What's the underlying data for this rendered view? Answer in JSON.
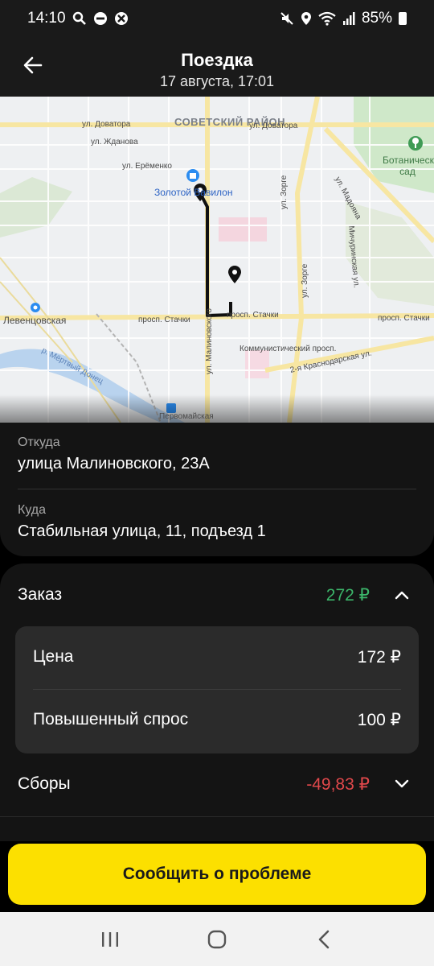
{
  "status_bar": {
    "time": "14:10",
    "battery": "85%",
    "left_icons": [
      "search-icon",
      "dnd-icon",
      "app-icon"
    ],
    "right_icons": [
      "mute-icon",
      "location-icon",
      "wifi-icon",
      "signal-icon",
      "battery-icon"
    ]
  },
  "header": {
    "title": "Поездка",
    "subtitle": "17 августа, 17:01"
  },
  "map": {
    "labels": {
      "district": "СОВЕТСКИЙ РАЙОН",
      "dovatora_1": "ул. Доватора",
      "dovatora_2": "ул. Доватора",
      "zhdanova": "ул. Жданова",
      "eremenko": "ул. Ерёменко",
      "zolotoy": "Золотой Вавилон",
      "botanic": "Ботанический сад",
      "madoyana": "ул. Мадояна",
      "zorge_1": "ул. Зорге",
      "zorge_2": "ул. Зорге",
      "michurinskaya": "Мичуринская ул.",
      "stachki_1": "просп. Стачки",
      "stachki_2": "просп. Стачки",
      "stachki_3": "просп. Стачки",
      "malinovskogo": "ул. Малиновского",
      "kommunisticheskiy": "Коммунистический просп.",
      "krasnodarskaya": "2-я Краснодарская ул.",
      "levencovskaya": "Левенцовская",
      "mertvy_donec": "р. Мёртвый Донец",
      "pervomayskaya": "Первомайская"
    },
    "route_color": "#111111"
  },
  "trip": {
    "from_caption": "Откуда",
    "from_value": "улица Малиновского, 23А",
    "to_caption": "Куда",
    "to_value": "Стабильная улица, 11, подъезд 1"
  },
  "order": {
    "label": "Заказ",
    "amount": "272 ₽",
    "amount_color": "#3cb56a",
    "price_label": "Цена",
    "price_value": "172 ₽",
    "surge_label": "Повышенный спрос",
    "surge_value": "100 ₽",
    "fees_label": "Сборы",
    "fees_value": "-49,83 ₽",
    "fees_color": "#e0484b"
  },
  "actions": {
    "report_label": "Сообщить о проблеме",
    "accent_color": "#fce000"
  },
  "nav": {
    "icons": [
      "recents-icon",
      "home-icon",
      "back-icon"
    ]
  }
}
